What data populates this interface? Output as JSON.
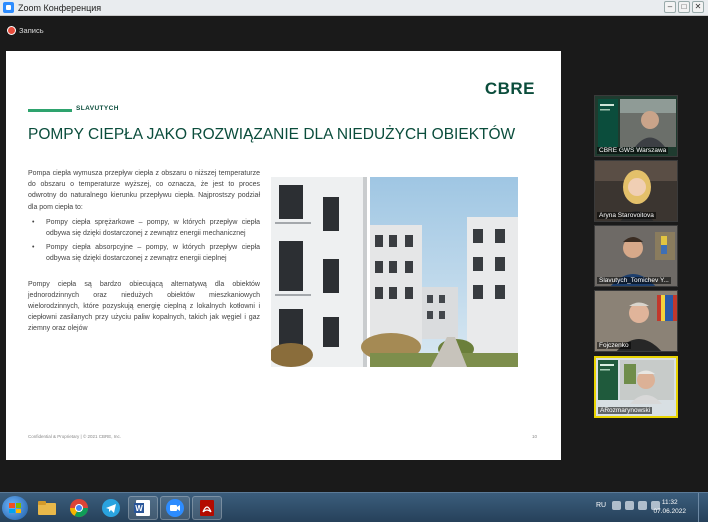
{
  "window": {
    "title": "Zoom Конференция",
    "controls": {
      "minimize": "–",
      "maximize": "□",
      "close": "✕"
    }
  },
  "recording": {
    "label": "Запись"
  },
  "slide": {
    "logo": "CBRE",
    "brand": "SLAVUTYCH",
    "title": "POMPY CIEPŁA JAKO ROZWIĄZANIE DLA NIEDUŻYCH OBIEKTÓW",
    "intro": "Pompa ciepła wymusza przepływ ciepła z obszaru o niższej temperaturze do obszaru o temperaturze wyższej, co oznacza, że jest to proces odwrotny do naturalnego kierunku przepływu ciepła. Najprostszy podział dla pom ciepła to:",
    "bullets": [
      "Pompy ciepła sprężarkowe – pompy, w których przepływ ciepła odbywa się dzięki dostarczonej z zewnątrz energii mechanicznej",
      "Pompy ciepła absorpcyjne – pompy, w których przepływ ciepła odbywa się dzięki dostarczonej z zewnątrz energii cieplnej"
    ],
    "conclusion": "Pompy ciepła są bardzo obiecującą alternatywą dla obiektów jednorodzinnych oraz niedużych obiektów mieszkaniowych wielorodzinnych, które pozyskują energię cieplną z lokalnych kotłowni i ciepłowni zasilanych przy użyciu paliw kopalnych, takich jak węgiel i gaz ziemny oraz olejów",
    "footer": "Confidential & Proprietary | © 2021 CBRE, Inc.",
    "page_number": "10"
  },
  "participants": [
    {
      "name": "CBRE GWS Warszawa",
      "active": false
    },
    {
      "name": "Aryna Starovoitova",
      "active": false
    },
    {
      "name": "Slavutych_Tomichev Y...",
      "active": false
    },
    {
      "name": "Fojczenko",
      "active": false
    },
    {
      "name": "ARozmarynowski",
      "active": true
    }
  ],
  "taskbar": {
    "apps": [
      "start-menu",
      "file-explorer",
      "libraries",
      "chrome",
      "telegram",
      "word",
      "zoom",
      "acrobat"
    ],
    "language": "RU",
    "time": "11:32",
    "date": "07.06.2022"
  },
  "colors": {
    "brand_green": "#0b4d3c",
    "accent_green": "#2ea36e",
    "active_speaker": "#e8d300"
  }
}
